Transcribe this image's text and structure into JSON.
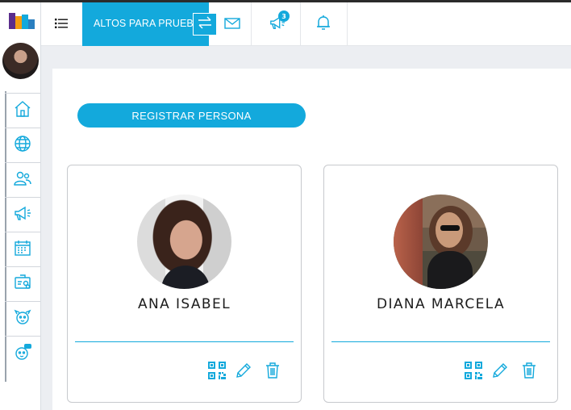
{
  "app": {
    "company_name": "ALTOS PARA PRUEBA",
    "accent_color": "#13a9dc",
    "notification_count": "3"
  },
  "topbar": {
    "icons": [
      "menu-list-icon",
      "swap-arrows-icon",
      "mail-icon",
      "megaphone-icon",
      "bell-icon"
    ]
  },
  "sidebar": {
    "items": [
      {
        "name": "home",
        "icon": "home-icon"
      },
      {
        "name": "globe",
        "icon": "globe-icon"
      },
      {
        "name": "people",
        "icon": "people-icon"
      },
      {
        "name": "announcements",
        "icon": "megaphone-icon"
      },
      {
        "name": "calendar",
        "icon": "calendar-icon"
      },
      {
        "name": "id-card",
        "icon": "id-card-icon"
      },
      {
        "name": "pets",
        "icon": "pet-icon"
      },
      {
        "name": "sos",
        "icon": "sos-icon"
      }
    ]
  },
  "main": {
    "register_button": "REGISTRAR PERSONA",
    "persons": [
      {
        "name": "ANA ISABEL"
      },
      {
        "name": "DIANA MARCELA"
      }
    ],
    "card_actions": [
      "qr-code-icon",
      "edit-pencil-icon",
      "trash-icon"
    ]
  }
}
